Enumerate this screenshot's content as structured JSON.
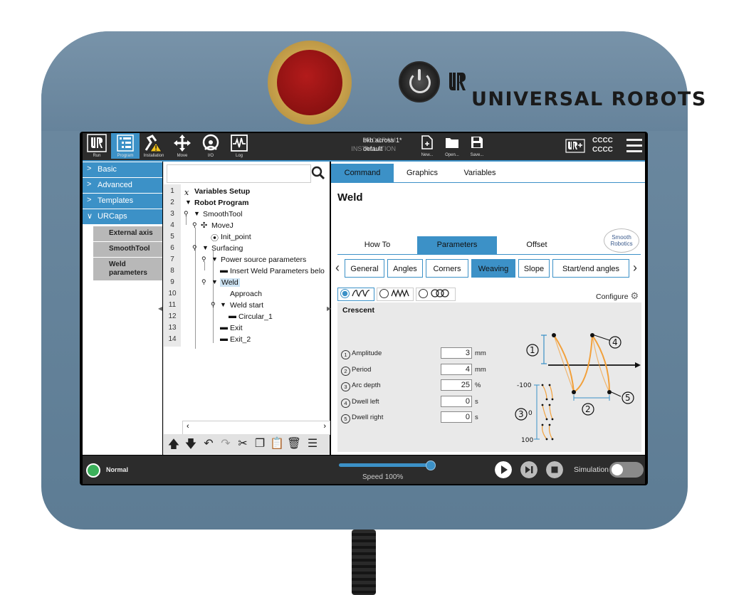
{
  "brand": {
    "name": "UNIVERSAL ROBOTS"
  },
  "topbar": {
    "items": [
      {
        "label": "Run",
        "icon": "ur-logo-icon"
      },
      {
        "label": "Program",
        "icon": "program-icon"
      },
      {
        "label": "Installation",
        "icon": "installation-icon"
      },
      {
        "label": "Move",
        "icon": "move-icon"
      },
      {
        "label": "I/O",
        "icon": "io-icon"
      },
      {
        "label": "Log",
        "icon": "log-icon"
      }
    ],
    "program_label": "PROGRAM",
    "program_value": "bkb across 1*",
    "installation_label": "INSTALLATION",
    "installation_value": "default",
    "file_buttons": [
      {
        "label": "New..."
      },
      {
        "label": "Open..."
      },
      {
        "label": "Save..."
      }
    ],
    "user_line1": "CCCC",
    "user_line2": "CCCC"
  },
  "sidebar": {
    "items": [
      {
        "label": "Basic",
        "chevron": ">"
      },
      {
        "label": "Advanced",
        "chevron": ">"
      },
      {
        "label": "Templates",
        "chevron": ">"
      },
      {
        "label": "URCaps",
        "chevron": "∨"
      }
    ],
    "sub_items": [
      {
        "label": "External axis"
      },
      {
        "label": "SmoothTool"
      },
      {
        "label": "Weld\nparameters"
      }
    ]
  },
  "tree": {
    "search_placeholder": "",
    "lines": [
      "1",
      "2",
      "3",
      "4",
      "5",
      "6",
      "7",
      "8",
      "9",
      "10",
      "11",
      "12",
      "13",
      "14"
    ],
    "nodes": [
      {
        "label": "Variables Setup"
      },
      {
        "label": "Robot Program"
      },
      {
        "label": "SmoothTool"
      },
      {
        "label": "MoveJ"
      },
      {
        "label": "Init_point"
      },
      {
        "label": "Surfacing"
      },
      {
        "label": "Power source parameters"
      },
      {
        "label": "Insert Weld Parameters belo"
      },
      {
        "label": "Weld"
      },
      {
        "label": "Approach"
      },
      {
        "label": "Weld start"
      },
      {
        "label": "Circular_1"
      },
      {
        "label": "Exit"
      },
      {
        "label": "Exit_2"
      }
    ]
  },
  "main_tabs": [
    {
      "label": "Command"
    },
    {
      "label": "Graphics"
    },
    {
      "label": "Variables"
    }
  ],
  "command": {
    "title": "Weld",
    "sub_tabs": [
      {
        "label": "How To"
      },
      {
        "label": "Parameters"
      },
      {
        "label": "Offset"
      }
    ],
    "smooth_logo": "Smooth\nRobotics",
    "categories": [
      {
        "label": "General"
      },
      {
        "label": "Angles"
      },
      {
        "label": "Corners"
      },
      {
        "label": "Weaving"
      },
      {
        "label": "Slope"
      },
      {
        "label": "Start/end angles"
      }
    ],
    "configure_label": "Configure",
    "pattern_name": "Crescent",
    "params": [
      {
        "num": "1",
        "label": "Amplitude",
        "value": "3",
        "unit": "mm"
      },
      {
        "num": "2",
        "label": "Period",
        "value": "4",
        "unit": "mm"
      },
      {
        "num": "3",
        "label": "Arc depth",
        "value": "25",
        "unit": "%"
      },
      {
        "num": "4",
        "label": "Dwell left",
        "value": "0",
        "unit": "s"
      },
      {
        "num": "5",
        "label": "Dwell right",
        "value": "0",
        "unit": "s"
      }
    ],
    "diagram": {
      "markers": [
        "1",
        "2",
        "3",
        "4",
        "5"
      ],
      "scale_labels": [
        "-100",
        "0",
        "100"
      ]
    }
  },
  "bottombar": {
    "status": "Normal",
    "speed_fraction": 1.0,
    "speed_label": "Speed 100%",
    "simulation_label": "Simulation",
    "simulation_on": false
  },
  "colors": {
    "accent": "#3c91c7",
    "bar": "#2c2c2c",
    "status_ok": "#3bb05a",
    "estop": "#a51616",
    "diagram_curve": "#f2a03a"
  }
}
